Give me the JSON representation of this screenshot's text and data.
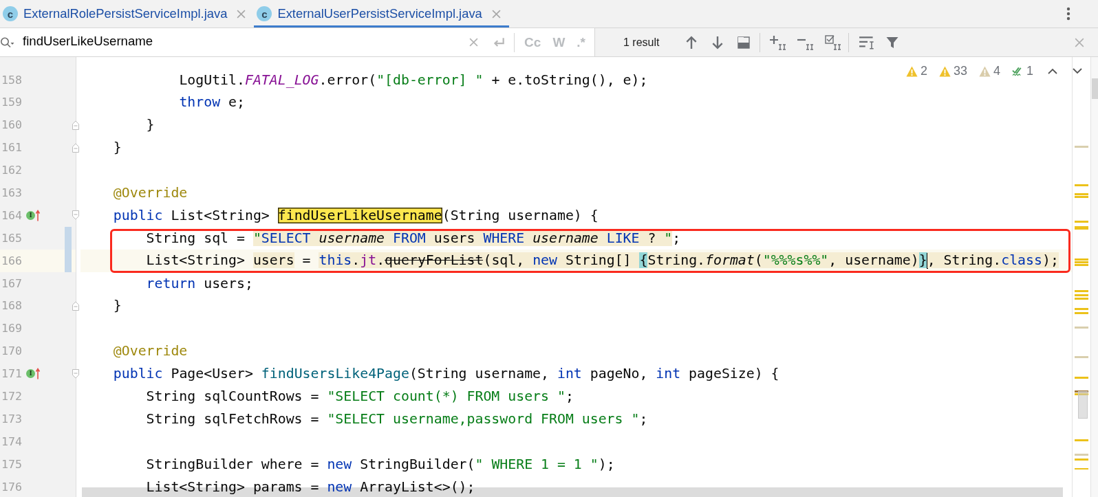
{
  "tabs": [
    {
      "label": "ExternalRolePersistServiceImpl.java",
      "icon_letter": "c",
      "selected": false
    },
    {
      "label": "ExternalUserPersistServiceImpl.java",
      "icon_letter": "c",
      "selected": true
    }
  ],
  "search": {
    "value": "findUserLikeUsername",
    "options": [
      {
        "label": "Cc",
        "selected": false
      },
      {
        "label": "W",
        "selected": false
      },
      {
        "label": ".*",
        "selected": false
      }
    ],
    "result": "1 result"
  },
  "inspections": [
    {
      "kind": "warning",
      "count": "2"
    },
    {
      "kind": "warning",
      "count": "33"
    },
    {
      "kind": "weak-warning",
      "count": "4"
    },
    {
      "kind": "typo",
      "count": "1"
    }
  ],
  "lines": [
    {
      "number": "158",
      "current": false,
      "changed": false,
      "outlined": false,
      "tokens": [
        {
          "kind": "plain",
          "text": "            LogUtil."
        },
        {
          "kind": "static-field",
          "text": "FATAL_LOG"
        },
        {
          "kind": "plain",
          "text": ".error("
        },
        {
          "kind": "string",
          "text": "\"[db-error] \""
        },
        {
          "kind": "plain",
          "text": " + e.toString(), e);"
        }
      ]
    },
    {
      "number": "159",
      "current": false,
      "changed": false,
      "outlined": false,
      "tokens": [
        {
          "kind": "keyword",
          "text": "            throw"
        },
        {
          "kind": "plain",
          "text": " e;"
        }
      ]
    },
    {
      "number": "160",
      "current": false,
      "changed": false,
      "outlined": false,
      "fold": {
        "kind": "end"
      },
      "tokens": [
        {
          "kind": "plain",
          "text": "        }"
        }
      ]
    },
    {
      "number": "161",
      "current": false,
      "changed": false,
      "outlined": false,
      "fold": {
        "kind": "end"
      },
      "tokens": [
        {
          "kind": "plain",
          "text": "    }"
        }
      ]
    },
    {
      "number": "162",
      "current": false,
      "changed": false,
      "outlined": false
    },
    {
      "number": "163",
      "current": false,
      "changed": false,
      "outlined": false,
      "tokens": [
        {
          "kind": "annotation",
          "text": "    @Override"
        }
      ]
    },
    {
      "number": "164",
      "current": false,
      "changed": false,
      "outlined": false,
      "fold": {
        "kind": "start"
      },
      "gutter_icon": {
        "kind": "implements",
        "letter": "I"
      },
      "tokens": [
        {
          "kind": "keyword",
          "text": "    public"
        },
        {
          "kind": "plain",
          "text": " List<String> "
        },
        {
          "kind": "plain",
          "text": "findUserLikeUsername",
          "highlight": {
            "kind": "match"
          }
        },
        {
          "kind": "plain",
          "text": "(String username) {"
        }
      ]
    },
    {
      "number": "165",
      "current": false,
      "changed": true,
      "outlined": true,
      "tokens": [
        {
          "kind": "plain",
          "text": "        String sql = "
        },
        {
          "kind": "string",
          "text": "\"",
          "highlight": {
            "kind": "warning"
          }
        },
        {
          "kind": "sql-keyword",
          "text": "SELECT",
          "highlight": {
            "kind": "warning"
          }
        },
        {
          "kind": "sql-column",
          "text": " username",
          "highlight": {
            "kind": "warning"
          }
        },
        {
          "kind": "sql-keyword",
          "text": " FROM",
          "highlight": {
            "kind": "warning"
          }
        },
        {
          "kind": "plain",
          "text": " users ",
          "highlight": {
            "kind": "warning"
          }
        },
        {
          "kind": "sql-keyword",
          "text": "WHERE",
          "highlight": {
            "kind": "warning"
          }
        },
        {
          "kind": "sql-column",
          "text": " username",
          "highlight": {
            "kind": "warning"
          }
        },
        {
          "kind": "sql-keyword",
          "text": " LIKE",
          "highlight": {
            "kind": "warning"
          }
        },
        {
          "kind": "plain",
          "text": " ? ",
          "highlight": {
            "kind": "warning"
          }
        },
        {
          "kind": "string",
          "text": "\"",
          "highlight": {
            "kind": "warning"
          }
        },
        {
          "kind": "plain",
          "text": ";"
        }
      ]
    },
    {
      "number": "166",
      "current": true,
      "changed": true,
      "outlined": true,
      "tokens": [
        {
          "kind": "plain",
          "text": "        List<String> "
        },
        {
          "kind": "plain",
          "text": "users",
          "highlight": {
            "kind": "warning"
          }
        },
        {
          "kind": "plain",
          "text": " = "
        },
        {
          "kind": "keyword",
          "text": "this",
          "highlight": {
            "kind": "warning"
          }
        },
        {
          "kind": "plain",
          "text": ".",
          "highlight": {
            "kind": "warning"
          }
        },
        {
          "kind": "field",
          "text": "jt",
          "highlight": {
            "kind": "warning"
          }
        },
        {
          "kind": "plain",
          "text": ".",
          "highlight": {
            "kind": "warning"
          }
        },
        {
          "kind": "deprecated",
          "text": "queryForList",
          "highlight": {
            "kind": "warning"
          }
        },
        {
          "kind": "plain",
          "text": "(sql, ",
          "highlight": {
            "kind": "warning"
          }
        },
        {
          "kind": "keyword",
          "text": "new",
          "highlight": {
            "kind": "warning"
          }
        },
        {
          "kind": "plain",
          "text": " String[] ",
          "highlight": {
            "kind": "warning"
          }
        },
        {
          "kind": "plain",
          "text": "{",
          "highlight": {
            "kind": "brace"
          }
        },
        {
          "kind": "plain",
          "text": "String.",
          "highlight": {
            "kind": "warning"
          }
        },
        {
          "kind": "static-call",
          "text": "format",
          "highlight": {
            "kind": "warning"
          }
        },
        {
          "kind": "plain",
          "text": "(",
          "highlight": {
            "kind": "warning"
          }
        },
        {
          "kind": "string",
          "text": "\"%%%s%%\"",
          "highlight": {
            "kind": "warning"
          }
        },
        {
          "kind": "plain",
          "text": ", username)",
          "highlight": {
            "kind": "warning"
          }
        },
        {
          "kind": "plain",
          "text": "}",
          "highlight": {
            "kind": "brace"
          }
        },
        {
          "kind": "caret"
        },
        {
          "kind": "plain",
          "text": ", String.",
          "highlight": {
            "kind": "warning"
          }
        },
        {
          "kind": "keyword",
          "text": "class",
          "highlight": {
            "kind": "warning"
          }
        },
        {
          "kind": "plain",
          "text": ");",
          "highlight": {
            "kind": "warning"
          }
        }
      ]
    },
    {
      "number": "167",
      "current": false,
      "changed": false,
      "outlined": false,
      "tokens": [
        {
          "kind": "keyword",
          "text": "        return"
        },
        {
          "kind": "plain",
          "text": " users;"
        }
      ]
    },
    {
      "number": "168",
      "current": false,
      "changed": false,
      "outlined": false,
      "fold": {
        "kind": "end"
      },
      "tokens": [
        {
          "kind": "plain",
          "text": "    }"
        }
      ]
    },
    {
      "number": "169",
      "current": false,
      "changed": false,
      "outlined": false
    },
    {
      "number": "170",
      "current": false,
      "changed": false,
      "outlined": false,
      "tokens": [
        {
          "kind": "annotation",
          "text": "    @Override"
        }
      ]
    },
    {
      "number": "171",
      "current": false,
      "changed": false,
      "outlined": false,
      "fold": {
        "kind": "start"
      },
      "gutter_icon": {
        "kind": "implements",
        "letter": "I"
      },
      "tokens": [
        {
          "kind": "keyword",
          "text": "    public"
        },
        {
          "kind": "plain",
          "text": " Page<User> "
        },
        {
          "kind": "declaration",
          "text": "findUsersLike4Page"
        },
        {
          "kind": "plain",
          "text": "(String username, "
        },
        {
          "kind": "keyword",
          "text": "int"
        },
        {
          "kind": "plain",
          "text": " pageNo, "
        },
        {
          "kind": "keyword",
          "text": "int"
        },
        {
          "kind": "plain",
          "text": " pageSize) {"
        }
      ]
    },
    {
      "number": "172",
      "current": false,
      "changed": false,
      "outlined": false,
      "tokens": [
        {
          "kind": "plain",
          "text": "        String sqlCountRows = "
        },
        {
          "kind": "string",
          "text": "\"SELECT count(*) FROM users \""
        },
        {
          "kind": "plain",
          "text": ";"
        }
      ]
    },
    {
      "number": "173",
      "current": false,
      "changed": false,
      "outlined": false,
      "tokens": [
        {
          "kind": "plain",
          "text": "        String sqlFetchRows = "
        },
        {
          "kind": "string",
          "text": "\"SELECT username,password FROM users \""
        },
        {
          "kind": "plain",
          "text": ";"
        }
      ]
    },
    {
      "number": "174",
      "current": false,
      "changed": false,
      "outlined": false
    },
    {
      "number": "175",
      "current": false,
      "changed": false,
      "outlined": false,
      "tokens": [
        {
          "kind": "plain",
          "text": "        StringBuilder where = "
        },
        {
          "kind": "keyword",
          "text": "new"
        },
        {
          "kind": "plain",
          "text": " StringBuilder("
        },
        {
          "kind": "string",
          "text": "\" WHERE 1 = 1 \""
        },
        {
          "kind": "plain",
          "text": ");"
        }
      ]
    },
    {
      "number": "176",
      "current": false,
      "changed": false,
      "outlined": false,
      "tokens": [
        {
          "kind": "plain",
          "text": "        List<String> params = "
        },
        {
          "kind": "keyword",
          "text": "new"
        },
        {
          "kind": "plain",
          "text": " ArrayList<>();"
        }
      ]
    }
  ]
}
